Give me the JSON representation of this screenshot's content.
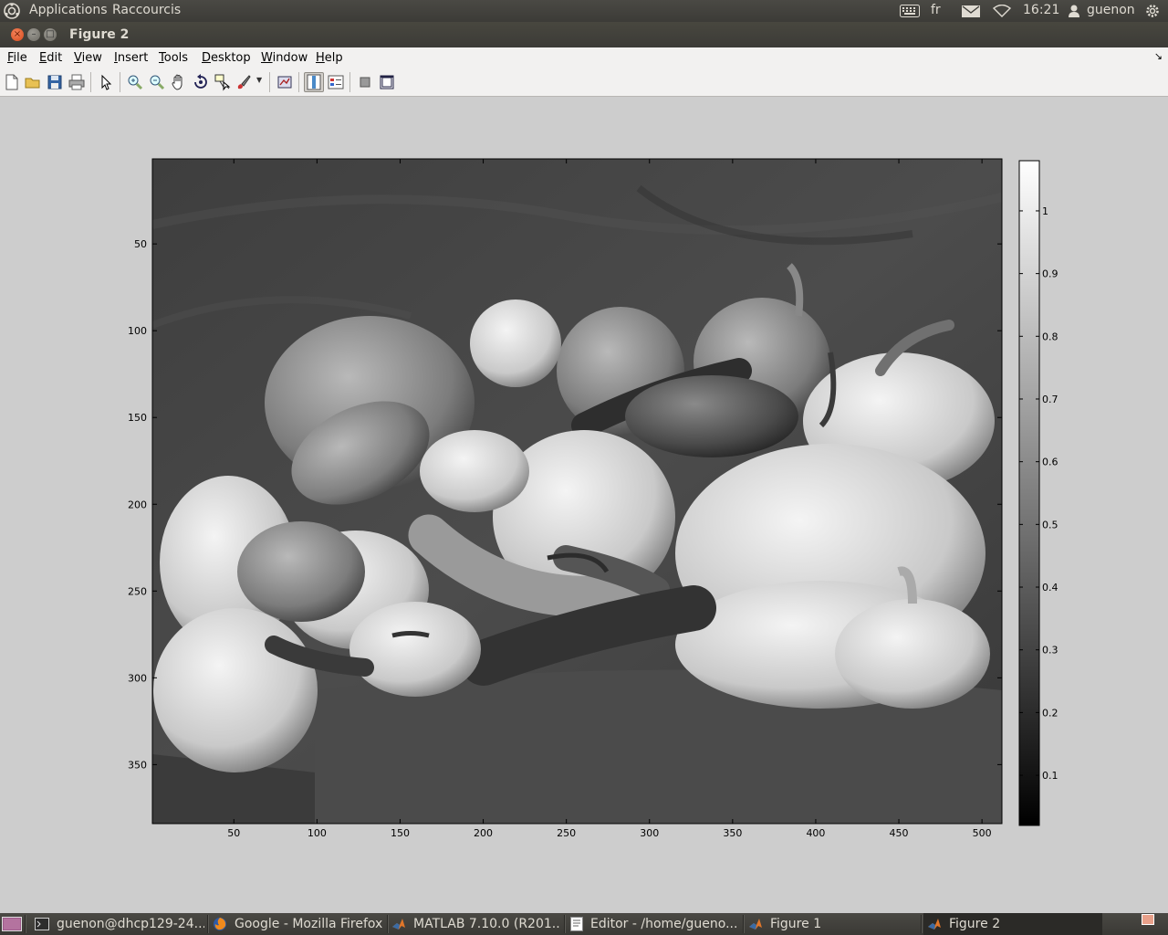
{
  "top_panel": {
    "menus": [
      "Applications",
      "Raccourcis"
    ],
    "keyboard_layout": "fr",
    "time": "16:21",
    "user": "guenon"
  },
  "window": {
    "title": "Figure 2"
  },
  "menu_bar": {
    "items": [
      "File",
      "Edit",
      "View",
      "Insert",
      "Tools",
      "Desktop",
      "Window",
      "Help"
    ]
  },
  "toolbar": {
    "buttons": [
      "new-figure-icon",
      "open-file-icon",
      "save-icon",
      "print-icon",
      "edit-plot-pointer-icon",
      "zoom-in-icon",
      "zoom-out-icon",
      "pan-hand-icon",
      "rotate-3d-icon",
      "data-cursor-icon",
      "brush-icon",
      "link-plot-icon",
      "colorbar-icon",
      "legend-icon",
      "hide-plot-tools-icon",
      "show-plot-tools-icon"
    ]
  },
  "chart_data": {
    "type": "heatmap",
    "description_of_content": "",
    "xlim": [
      1,
      512
    ],
    "ylim": [
      384,
      1
    ],
    "x_ticks": [
      50,
      100,
      150,
      200,
      250,
      300,
      350,
      400,
      450,
      500
    ],
    "y_ticks": [
      50,
      100,
      150,
      200,
      250,
      300,
      350
    ],
    "colormap": "gray",
    "colorbar": {
      "ticks": [
        0.1,
        0.2,
        0.3,
        0.4,
        0.5,
        0.6,
        0.7,
        0.8,
        0.9,
        1
      ],
      "tick_labels": [
        "0.1",
        "0.2",
        "0.3",
        "0.4",
        "0.5",
        "0.6",
        "0.7",
        "0.8",
        "0.9",
        "1"
      ],
      "clim": [
        0.02,
        1.08
      ]
    }
  },
  "taskbar": {
    "tasks": [
      {
        "label": "guenon@dhcp129-24...",
        "icon": "terminal-icon",
        "active": false
      },
      {
        "label": "Google - Mozilla Firefox",
        "icon": "firefox-icon",
        "active": false
      },
      {
        "label": "MATLAB 7.10.0 (R201...",
        "icon": "matlab-icon",
        "active": false
      },
      {
        "label": "Editor - /home/gueno...",
        "icon": "editor-icon",
        "active": false
      },
      {
        "label": "Figure 1",
        "icon": "matlab-icon",
        "active": false
      },
      {
        "label": "Figure 2",
        "icon": "matlab-icon",
        "active": true
      }
    ]
  }
}
